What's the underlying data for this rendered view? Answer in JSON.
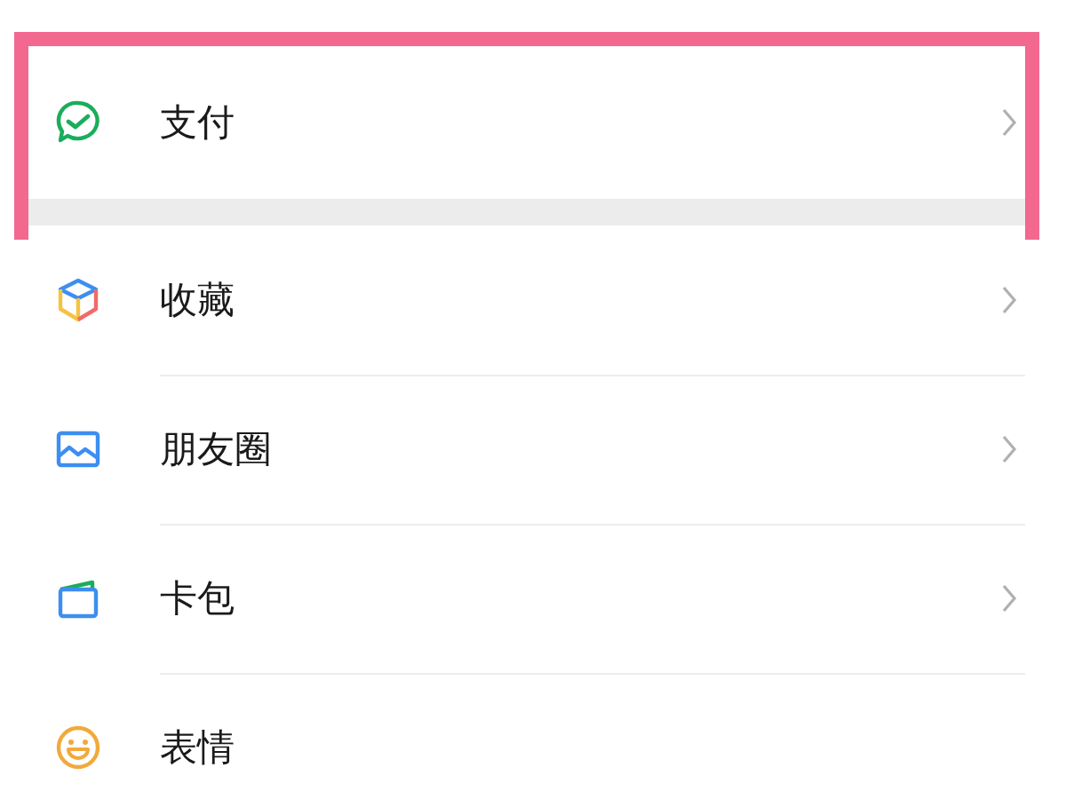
{
  "sections": [
    {
      "highlighted": true,
      "items": [
        {
          "kind": "pay",
          "label": "支付",
          "chevron": true
        }
      ]
    },
    {
      "highlighted": false,
      "items": [
        {
          "kind": "favorites",
          "label": "收藏",
          "chevron": true
        },
        {
          "kind": "moments",
          "label": "朋友圈",
          "chevron": true
        },
        {
          "kind": "cards",
          "label": "卡包",
          "chevron": true
        },
        {
          "kind": "stickers",
          "label": "表情",
          "chevron": false
        }
      ]
    }
  ]
}
